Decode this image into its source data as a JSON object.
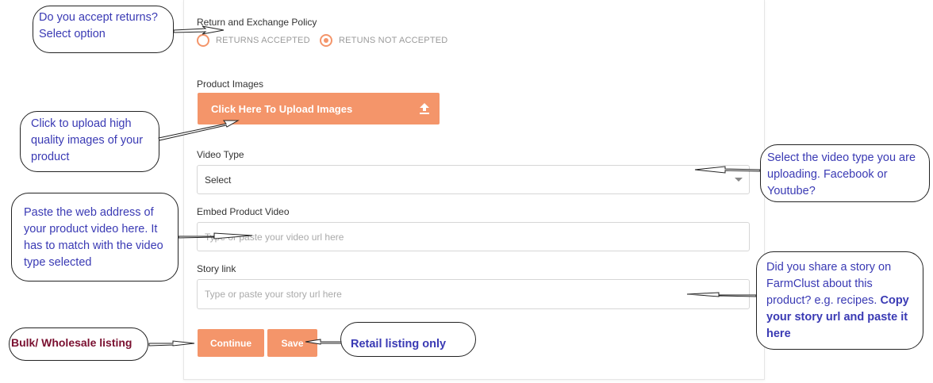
{
  "form": {
    "return_label": "Return and Exchange Policy",
    "radio_accepted": "RETURNS ACCEPTED",
    "radio_not_accepted": "RETUNS NOT ACCEPTED",
    "images_label": "Product Images",
    "upload_button": "Click Here To Upload Images",
    "video_type_label": "Video Type",
    "video_type_value": "Select",
    "embed_label": "Embed Product Video",
    "embed_placeholder": "Type or paste your video url here",
    "story_label": "Story link",
    "story_placeholder": "Type or paste your story url here",
    "continue_button": "Continue",
    "save_button": "Save"
  },
  "callouts": {
    "returns_line1": "Do you accept returns?",
    "returns_line2": "Select option",
    "upload": "Click to upload high quality images of your product",
    "video_type": "Select the video type you are uploading. Facebook or Youtube?",
    "embed": "Paste the web address of your product video here. It has to match with the video type selected",
    "story_plain": "Did you share a story on FarmClust about this product? e.g. recipes.",
    "story_bold": "Copy your story url and paste it here",
    "bulk": "Bulk/ Wholesale listing",
    "retail": "Retail listing only"
  },
  "colors": {
    "accent": "#f4956a",
    "callout_text": "#3a3ab4",
    "bulk_text": "#7a1030"
  }
}
